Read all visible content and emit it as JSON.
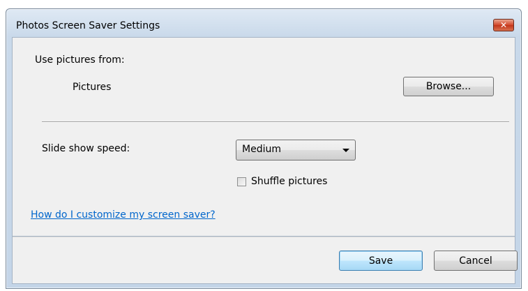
{
  "window": {
    "title": "Photos Screen Saver Settings",
    "close_label": "✕"
  },
  "pictures": {
    "section_label": "Use pictures from:",
    "folder_name": "Pictures",
    "browse_label": "Browse..."
  },
  "speed": {
    "label": "Slide show speed:",
    "selected": "Medium"
  },
  "shuffle": {
    "label": "Shuffle pictures",
    "checked": false
  },
  "help_link": "How do I customize my screen saver?",
  "footer": {
    "save_label": "Save",
    "cancel_label": "Cancel"
  },
  "colors": {
    "link": "#0066cc",
    "close_button": "#c94a30",
    "default_button_border": "#3c7fb1"
  }
}
